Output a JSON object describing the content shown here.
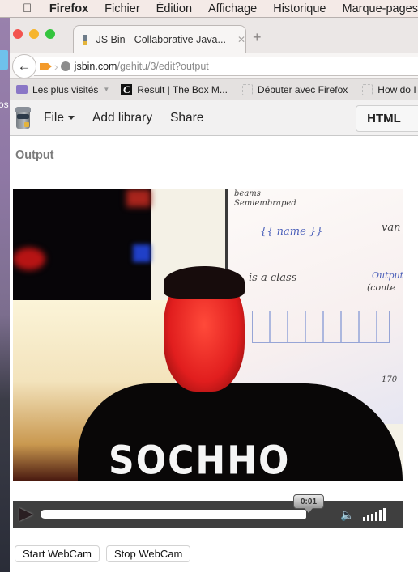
{
  "menubar": {
    "apple_icon": "apple-logo",
    "items": [
      "Firefox",
      "Fichier",
      "Édition",
      "Affichage",
      "Historique",
      "Marque-pages"
    ]
  },
  "desktop": {
    "label_fragment": "os"
  },
  "browser": {
    "tab": {
      "favicon": "jsbin-icon",
      "title": "JS Bin - Collaborative Java...",
      "close_glyph": "✕"
    },
    "new_tab_glyph": "+",
    "back_glyph": "🡐",
    "url": {
      "host": "jsbin.com",
      "path": "/gehitu/3/edit?output"
    },
    "bookmarks": [
      {
        "icon": "folder-icon",
        "label": "Les plus visités",
        "has_dropdown": true
      },
      {
        "icon": "c-logo-icon",
        "icon_glyph": "C",
        "label": "Result | The Box M..."
      },
      {
        "icon": "blank-page-icon",
        "label": "Débuter avec Firefox"
      },
      {
        "icon": "blank-page-icon",
        "label": "How do I enri"
      }
    ]
  },
  "jsbin": {
    "menu": {
      "file": "File",
      "add_library": "Add library",
      "share": "Share"
    },
    "panel_tabs": [
      "HTML"
    ],
    "output_label": "Output"
  },
  "video": {
    "shirt_text": "SOCHHO",
    "board_scribbles": [
      "beams",
      "Semiembraped",
      "{{ name }}",
      "van",
      "is a class",
      "Output",
      "(conte",
      "170"
    ],
    "controls": {
      "time": "0:01",
      "progress_fraction": 1.0,
      "volume_bars": 6
    }
  },
  "buttons": {
    "start": "Start WebCam",
    "stop": "Stop WebCam"
  }
}
